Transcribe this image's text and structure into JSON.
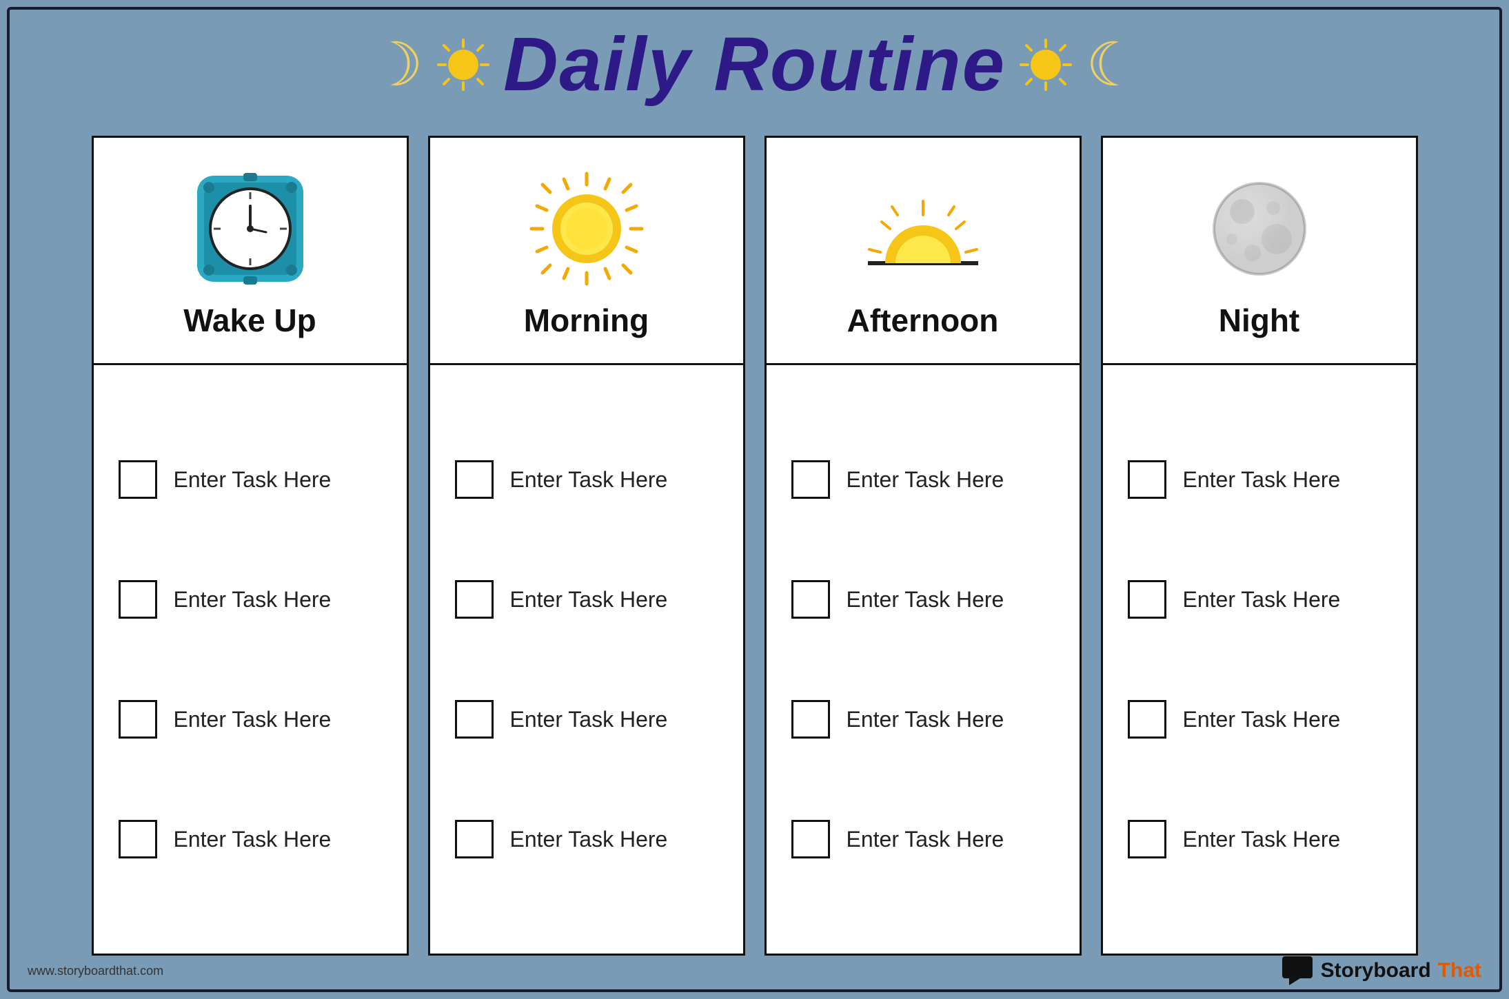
{
  "page": {
    "title": "Daily Routine",
    "background_color": "#7a9bb5",
    "title_color": "#2e1a87"
  },
  "header": {
    "title": "Daily Routine",
    "decorators": [
      "🌙",
      "✨",
      "🌙",
      "✨"
    ]
  },
  "columns": [
    {
      "id": "wake-up",
      "title": "Wake Up",
      "icon_type": "clock",
      "tasks": [
        "Enter Task Here",
        "Enter Task Here",
        "Enter Task Here",
        "Enter Task Here"
      ]
    },
    {
      "id": "morning",
      "title": "Morning",
      "icon_type": "sun-full",
      "tasks": [
        "Enter Task Here",
        "Enter Task Here",
        "Enter Task Here",
        "Enter Task Here"
      ]
    },
    {
      "id": "afternoon",
      "title": "Afternoon",
      "icon_type": "sun-horizon",
      "tasks": [
        "Enter Task Here",
        "Enter Task Here",
        "Enter Task Here",
        "Enter Task Here"
      ]
    },
    {
      "id": "night",
      "title": "Night",
      "icon_type": "moon",
      "tasks": [
        "Enter Task Here",
        "Enter Task Here",
        "Enter Task Here",
        "Enter Task Here"
      ]
    }
  ],
  "footer": {
    "url": "www.storyboardthat.com",
    "brand_name": "Storyboard",
    "brand_suffix": "That"
  },
  "task_placeholder": "Enter Task Here"
}
